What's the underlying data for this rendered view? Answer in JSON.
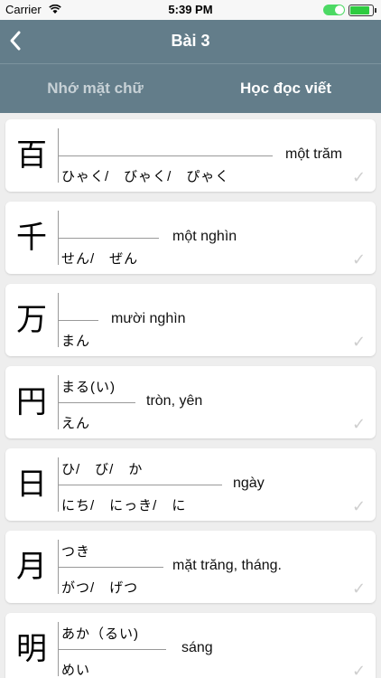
{
  "status": {
    "carrier": "Carrier",
    "time": "5:39 PM"
  },
  "nav": {
    "title": "Bài 3",
    "back_icon": "chevron-left-icon"
  },
  "tabs": [
    {
      "label": "Nhớ mặt chữ",
      "active": false
    },
    {
      "label": "Học đọc viết",
      "active": true
    }
  ],
  "cards": [
    {
      "kanji": "百",
      "kun": "",
      "on": "ひゃく/　びゃく/　ぴゃく",
      "meaning": "một trăm"
    },
    {
      "kanji": "千",
      "kun": "",
      "on": "せん/　ぜん",
      "meaning": "một nghìn"
    },
    {
      "kanji": "万",
      "kun": "",
      "on": "まん",
      "meaning": "mười nghìn"
    },
    {
      "kanji": "円",
      "kun": "まる(い)",
      "on": "えん",
      "meaning": "tròn, yên"
    },
    {
      "kanji": "日",
      "kun": "ひ/　び/　か",
      "on": "にち/　にっき/　に",
      "meaning": "ngày"
    },
    {
      "kanji": "月",
      "kun": "つき",
      "on": "がつ/　げつ",
      "meaning": "mặt trăng, tháng."
    },
    {
      "kanji": "明",
      "kun": "あか（るい)",
      "on": "めい",
      "meaning": "sáng"
    }
  ]
}
